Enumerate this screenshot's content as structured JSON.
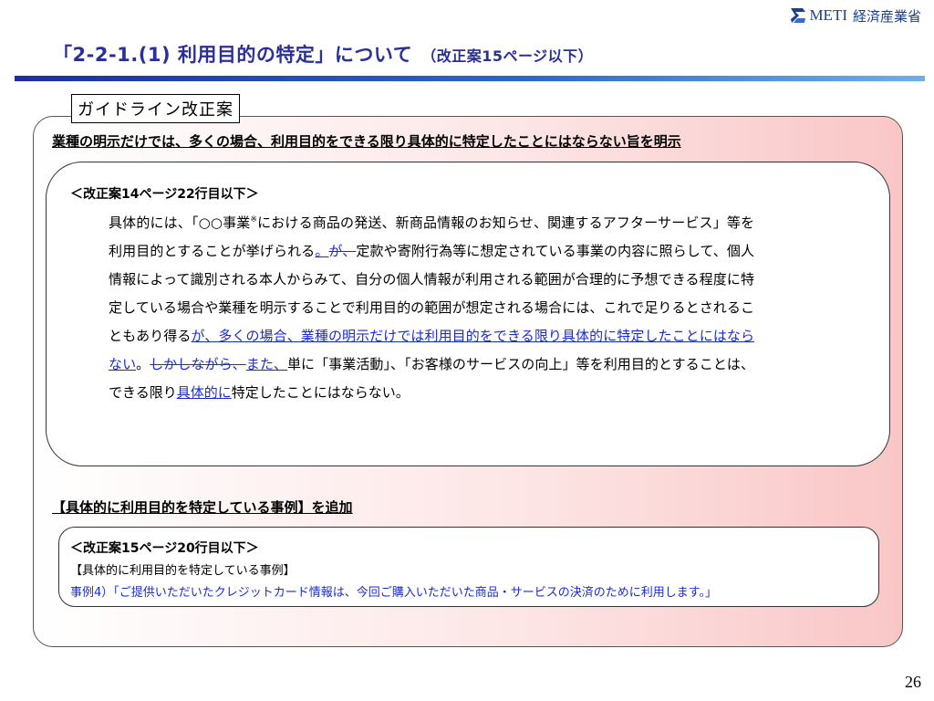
{
  "header": {
    "logo_text": "METI",
    "ministry": "経済産業省",
    "title": "「2-2-1.(1) 利用目的の特定」について",
    "subtitle": "（改正案15ページ以下）"
  },
  "tab_label": "ガイドライン改正案",
  "section1": {
    "headline": "業種の明示だけでは、多くの場合、利用目的をできる限り具体的に特定したことにはならない旨を明示",
    "ref": "＜改正案14ページ22行目以下＞",
    "body": {
      "t1": "具体的には、「○○事業",
      "asterisk": "※",
      "t2": "における商品の発送、新商品情報のお知らせ、関連するアフターサービス」等を利用目的とすることが挙げられる",
      "ins1": "。",
      "del1": "が、",
      "t3": "定款や寄附行為等に想定されている事業の内容に照らして、個人情報によって識別される本人からみて、自分の個人情報が利用される範囲が合理的に予想できる程度に特定している場合や業種を明示することで利用目的の範囲が想定される場合には、これで足りるとされることもあり得る",
      "ins2": "が、多くの場合、業種の明示だけでは利用目的をできる限り具体的に特定したことにはならない",
      "t4": "。",
      "del2": "しかしながら、",
      "ins3": "また、",
      "t5": "単に「事業活動」、「お客様のサービスの向上」等を利用目的とすることは、できる限り",
      "ins4": "具体的に",
      "t6": "特定したことにはならない。"
    }
  },
  "section2": {
    "headline": "【具体的に利用目的を特定している事例】を追加",
    "ref": "＜改正案15ページ20行目以下＞",
    "heading": "【具体的に利用目的を特定している事例】",
    "example": "事例4）「ご提供いただいたクレジットカード情報は、今回ご購入いただいた商品・サービスの決済のために利用します。」"
  },
  "page_number": "26"
}
